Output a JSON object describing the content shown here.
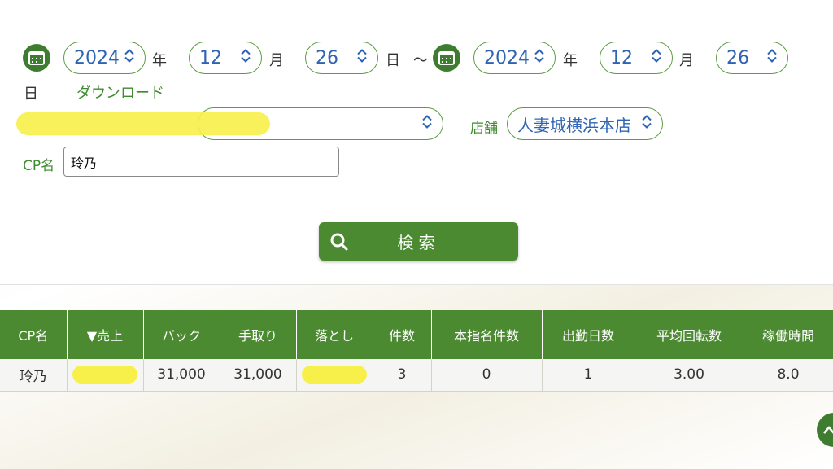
{
  "date_range": {
    "start": {
      "year": "2024",
      "month": "12",
      "day": "26"
    },
    "end": {
      "year": "2024",
      "month": "12",
      "day": "26"
    },
    "year_unit": "年",
    "month_unit": "月",
    "day_unit": "日",
    "separator": "～"
  },
  "download_label": "ダウンロード",
  "category_select": {
    "value": ""
  },
  "store": {
    "label": "店舗",
    "value": "人妻城横浜本店"
  },
  "cp_name": {
    "label": "CP名",
    "value": "玲乃"
  },
  "search_button": {
    "label": "検索"
  },
  "table": {
    "headers": [
      "CP名",
      "▼売上",
      "バック",
      "手取り",
      "落とし",
      "件数",
      "本指名件数",
      "出勤日数",
      "平均回転数",
      "稼働時間"
    ],
    "rows": [
      [
        "玲乃",
        "",
        "31,000",
        "31,000",
        "",
        "3",
        "0",
        "1",
        "3.00",
        "8.0"
      ]
    ]
  },
  "colors": {
    "accent": "#4c8a32",
    "select_text": "#2f64b4",
    "highlight": "#f8f04a"
  },
  "icons": [
    "calendar-icon",
    "chevron-updown-icon",
    "search-icon",
    "chevron-up-icon"
  ]
}
